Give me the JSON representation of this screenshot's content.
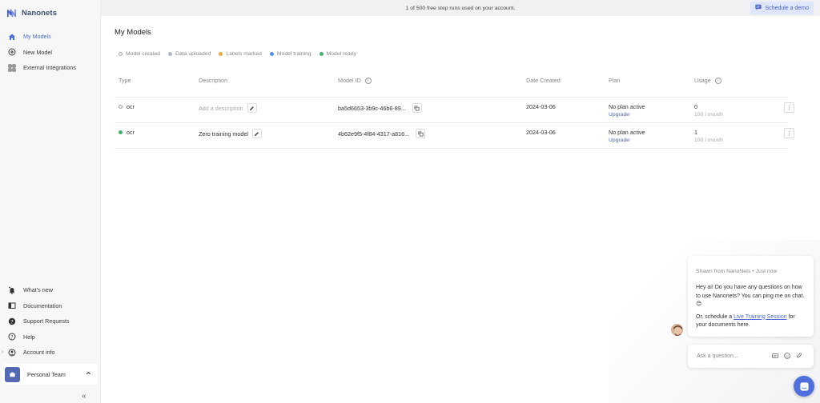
{
  "brand": {
    "name": "Nanonets"
  },
  "banner": {
    "text": "1 of 500 free step runs used on your account.",
    "demo_label": "Schedule a demo"
  },
  "sidebar": {
    "items": [
      {
        "label": "My Models",
        "icon": "home-icon",
        "active": true
      },
      {
        "label": "New Model",
        "icon": "plus-circle-icon"
      },
      {
        "label": "External Integrations",
        "icon": "grid-icon"
      }
    ],
    "bottom_items": [
      {
        "label": "What's new",
        "icon": "bell-icon"
      },
      {
        "label": "Documentation",
        "icon": "book-icon"
      },
      {
        "label": "Support Requests",
        "icon": "question-icon"
      },
      {
        "label": "Help",
        "icon": "help-circle-icon"
      },
      {
        "label": "Account info",
        "icon": "user-circle-icon"
      }
    ],
    "team": {
      "label": "Personal Team"
    }
  },
  "main": {
    "title": "My Models",
    "legend": [
      {
        "label": "Model created",
        "color": "#9aa0a6",
        "hollow": true
      },
      {
        "label": "Data uploaded",
        "color": "#b0b8c4"
      },
      {
        "label": "Labels marked",
        "color": "#f0a93b"
      },
      {
        "label": "Model training",
        "color": "#5b8def"
      },
      {
        "label": "Model ready",
        "color": "#3fb56c"
      }
    ],
    "columns": {
      "type": "Type",
      "description": "Description",
      "model_id": "Model ID",
      "date_created": "Date Created",
      "plan": "Plan",
      "usage": "Usage"
    },
    "rows": [
      {
        "type": "ocr",
        "status_color": "#9aa0a6",
        "status_hollow": true,
        "description": "Add a description",
        "description_placeholder": true,
        "model_id": "ba5d6653-3b9c-46b6-89...",
        "date_created": "2024-03-06",
        "plan": "No plan active",
        "plan_link": "Upgrade",
        "usage": "0",
        "usage_limit": "100 / month"
      },
      {
        "type": "ocr",
        "status_color": "#3fb56c",
        "status_hollow": false,
        "description": "Zero training model",
        "description_placeholder": false,
        "model_id": "4b62e9f5-4f84-4317-a816...",
        "date_created": "2024-03-06",
        "plan": "No plan active",
        "plan_link": "Upgrade",
        "usage": "1",
        "usage_limit": "100 / month"
      }
    ]
  },
  "chat": {
    "from": "Shawn from NanoNets",
    "time": "Just now",
    "message1": "Hey ai! Do you have any questions on how to use Nanonets? You can ping me on chat. 😊",
    "message2_prefix": "Or, schedule a ",
    "message2_link": "Live Training Session",
    "message2_suffix": " for your documents here.",
    "input_placeholder": "Ask a question..."
  }
}
